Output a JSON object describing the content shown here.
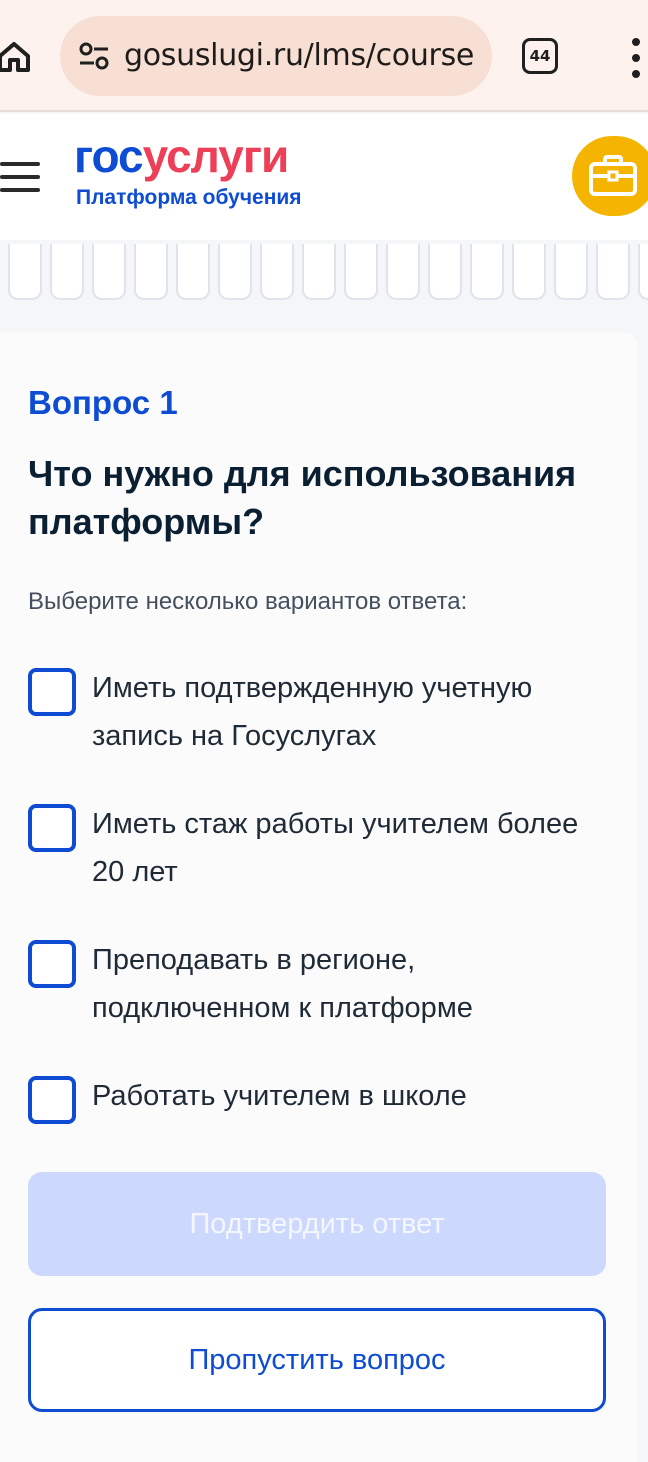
{
  "browser": {
    "url": "gosuslugi.ru/lms/courses",
    "tab_count": "44",
    "icons": {
      "home": "home-icon",
      "site_settings": "tune-icon",
      "menu": "more-vert-icon"
    }
  },
  "header": {
    "logo_part1": "гос",
    "logo_part2": "услуги",
    "subtitle": "Платформа обучения",
    "colors": {
      "brand_blue": "#0d4cd3",
      "brand_red": "#ee3f58",
      "portfolio_yellow": "#f5b400"
    },
    "icons": {
      "menu": "hamburger-icon",
      "portfolio": "briefcase-icon"
    }
  },
  "progress": {
    "cell_count": 16
  },
  "question": {
    "number_label": "Вопрос 1",
    "title": "Что нужно для использования платформы?",
    "hint": "Выберите несколько вариантов ответа:",
    "options": [
      {
        "label": "Иметь подтвержденную учетную запись на Госуслугах",
        "checked": false
      },
      {
        "label": "Иметь стаж работы учителем более 20 лет",
        "checked": false
      },
      {
        "label": "Преподавать в регионе, подключенном к платформе",
        "checked": false
      },
      {
        "label": "Работать учителем в школе",
        "checked": false
      }
    ]
  },
  "actions": {
    "confirm_label": "Подтвердить ответ",
    "confirm_disabled": true,
    "skip_label": "Пропустить вопрос"
  }
}
